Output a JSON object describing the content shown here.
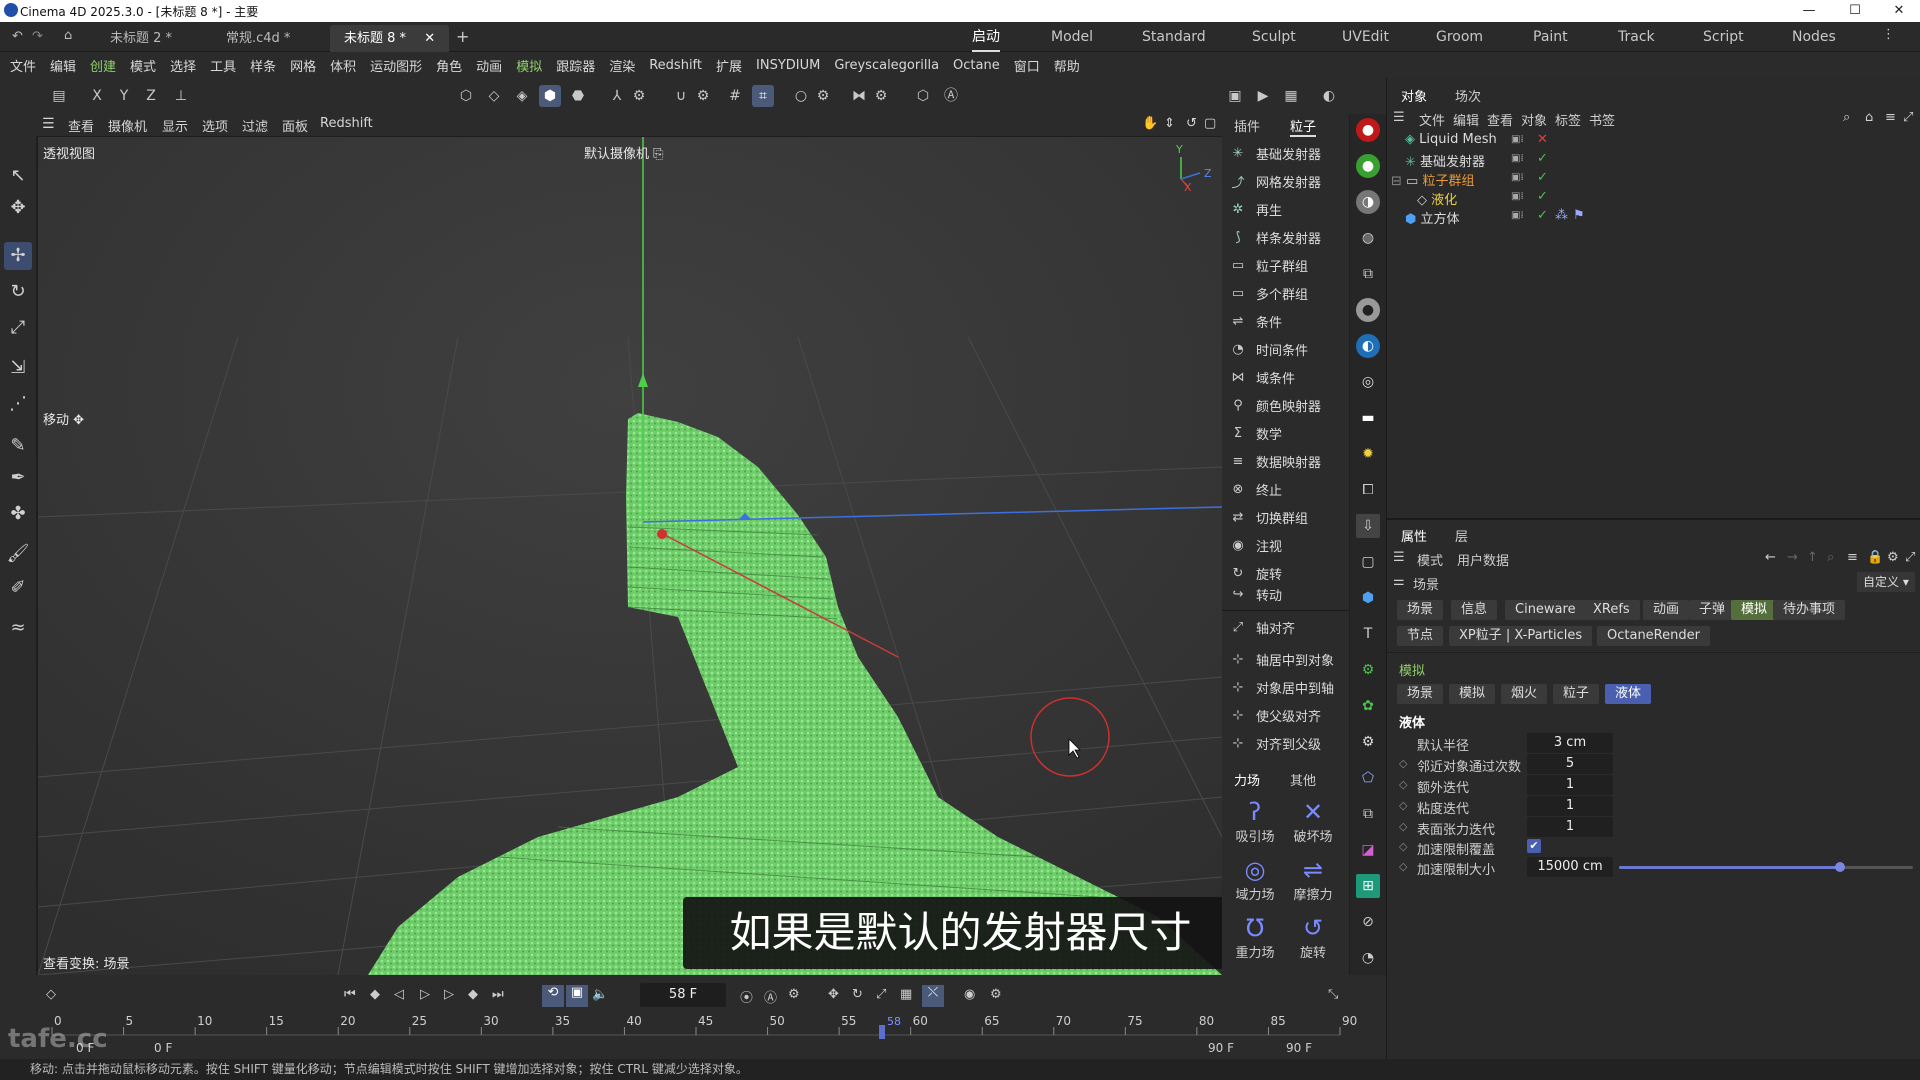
{
  "window": {
    "title": "Cinema 4D 2025.3.0 - [未标题 8 *] - 主要",
    "controls": [
      "—",
      "☐",
      "✕"
    ]
  },
  "doc_tabs": [
    "未标题 2 *",
    "常规.c4d *",
    "未标题 8 *"
  ],
  "layout_tabs": [
    "启动",
    "Model",
    "Standard",
    "Sculpt",
    "UVEdit",
    "Groom",
    "Paint",
    "Track",
    "Script",
    "Nodes"
  ],
  "menu": [
    "文件",
    "编辑",
    "创建",
    "模式",
    "选择",
    "工具",
    "样条",
    "网格",
    "体积",
    "运动图形",
    "角色",
    "动画",
    "模拟",
    "跟踪器",
    "渲染",
    "Redshift",
    "扩展",
    "INSYDIUM",
    "Greyscalegorilla",
    "Octane",
    "窗口",
    "帮助"
  ],
  "axis_buttons": [
    "X",
    "Y",
    "Z"
  ],
  "viewport": {
    "menu": [
      "查看",
      "摄像机",
      "显示",
      "选项",
      "过滤",
      "面板",
      "Redshift"
    ],
    "name": "透视视图",
    "camera": "默认摄像机",
    "tool_label": "移动",
    "transform_label": "查看变换: 场景",
    "subtitle": "如果是默认的发射器尺寸",
    "axis_y": "Y",
    "axis_z": "Z",
    "axis_x": "X"
  },
  "particle_panel": {
    "tabs": [
      "插件",
      "粒子"
    ],
    "items": [
      "基础发射器",
      "网格发射器",
      "再生",
      "样条发射器",
      "粒子群组",
      "多个群组",
      "条件",
      "时间条件",
      "域条件",
      "颜色映射器",
      "数学",
      "数据映射器",
      "终止",
      "切换群组",
      "注视",
      "旋转",
      "转动"
    ],
    "align_items": [
      "轴对齐",
      "轴居中到对象",
      "对象居中到轴",
      "使父级对齐",
      "对齐到父级"
    ],
    "force_tabs": [
      "力场",
      "其他"
    ],
    "forces": [
      "吸引场",
      "破坏场",
      "域力场",
      "摩擦力",
      "重力场",
      "旋转"
    ]
  },
  "timeline": {
    "current_frame": "58 F",
    "ticks": [
      "0",
      "5",
      "10",
      "15",
      "20",
      "25",
      "30",
      "35",
      "40",
      "45",
      "50",
      "55",
      "60",
      "65",
      "70",
      "75",
      "80",
      "85",
      "90"
    ],
    "playhead_label": "58",
    "start_a": "0 F",
    "start_b": "0 F",
    "end_a": "90 F",
    "end_b": "90 F",
    "current_value": 58,
    "range_max": 90
  },
  "statusbar": "移动: 点击并拖动鼠标移动元素。按住 SHIFT 键量化移动；节点编辑模式时按住 SHIFT 键增加选择对象；按住 CTRL 键减少选择对象。",
  "watermark": "tafe.cc",
  "object_manager": {
    "tabs": [
      "对象",
      "场次"
    ],
    "menu": [
      "文件",
      "编辑",
      "查看",
      "对象",
      "标签",
      "书签"
    ],
    "objects": [
      {
        "name": "Liquid Mesh",
        "status": "✕",
        "color": "#d0d0d0",
        "status_color": "#e04040"
      },
      {
        "name": "基础发射器",
        "status": "✓",
        "color": "#d0d0d0",
        "status_color": "#4fc04f"
      },
      {
        "name": "粒子群组",
        "status": "✓",
        "color": "#e89a3a",
        "status_color": "#4fc04f"
      },
      {
        "name": "液化",
        "status": "✓",
        "color": "#f0d040",
        "status_color": "#4fc04f"
      },
      {
        "name": "立方体",
        "status": "✓",
        "color": "#d0d0d0",
        "status_color": "#4fc04f"
      }
    ]
  },
  "attributes": {
    "tabs": [
      "属性",
      "层"
    ],
    "menu": [
      "模式",
      "用户数据"
    ],
    "section": "场景",
    "custom": "自定义",
    "row1": [
      "场景",
      "信息",
      "Cineware",
      "XRefs",
      "动画",
      "子弹",
      "模拟",
      "待办事项"
    ],
    "row2": [
      "节点",
      "XP粒子 | X-Particles",
      "OctaneRender"
    ],
    "sim_title": "模拟",
    "sim_tabs": [
      "场景",
      "模拟",
      "烟火",
      "粒子",
      "液体"
    ],
    "liquid_title": "液体",
    "props": [
      {
        "label": "默认半径",
        "value": "3 cm"
      },
      {
        "label": "邻近对象通过次数",
        "value": "5"
      },
      {
        "label": "额外迭代",
        "value": "1"
      },
      {
        "label": "粘度迭代",
        "value": "1"
      },
      {
        "label": "表面张力迭代",
        "value": "1"
      },
      {
        "label": "加速限制覆盖",
        "value": "✔"
      },
      {
        "label": "加速限制大小",
        "value": "15000 cm"
      }
    ],
    "accel_slider_fraction": 0.75
  },
  "colors": {
    "particles": "#7ed87a",
    "accent_blue": "#4a5fb0",
    "accent_green": "#556f3c",
    "cursor_ring": "#d03030"
  }
}
